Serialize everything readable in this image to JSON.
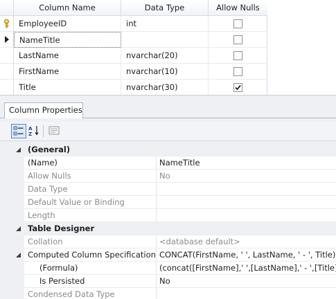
{
  "grid": {
    "headers": [
      "Column Name",
      "Data Type",
      "Allow Nulls"
    ],
    "rows": [
      {
        "name": "EmployeeID",
        "type": "int",
        "allow_nulls": false,
        "marker": "key-icon"
      },
      {
        "name": "NameTitle",
        "type": "",
        "allow_nulls": false,
        "marker": "row-pointer-icon"
      },
      {
        "name": "LastName",
        "type": "nvarchar(20)",
        "allow_nulls": false,
        "marker": ""
      },
      {
        "name": "FirstName",
        "type": "nvarchar(10)",
        "allow_nulls": false,
        "marker": ""
      },
      {
        "name": "Title",
        "type": "nvarchar(30)",
        "allow_nulls": true,
        "marker": ""
      }
    ]
  },
  "properties": {
    "tab_label": "Column Properties",
    "toolbar": [
      "categorized-icon",
      "alphabetical-sort-icon",
      "property-pages-icon"
    ],
    "rows": [
      {
        "kind": "cat",
        "name": "(General)",
        "value": ""
      },
      {
        "kind": "prop",
        "name": "(Name)",
        "value": "NameTitle",
        "dim": false
      },
      {
        "kind": "prop",
        "name": "Allow Nulls",
        "value": "No",
        "dim": true
      },
      {
        "kind": "prop",
        "name": "Data Type",
        "value": "",
        "dim": true
      },
      {
        "kind": "prop",
        "name": "Default Value or Binding",
        "value": "",
        "dim": true
      },
      {
        "kind": "prop",
        "name": "Length",
        "value": "",
        "dim": true
      },
      {
        "kind": "cat",
        "name": "Table Designer",
        "value": ""
      },
      {
        "kind": "prop",
        "name": "Collation",
        "value": "<database default>",
        "dim": true
      },
      {
        "kind": "expanded",
        "name": "Computed Column Specification",
        "value": "CONCAT(FirstName, ' ', LastName, ' - ', Title)",
        "dim": false
      },
      {
        "kind": "sub",
        "name": "(Formula)",
        "value": "(concat([FirstName],' ',[LastName],' - ',[Title]))",
        "dim": false
      },
      {
        "kind": "sub",
        "name": "Is Persisted",
        "value": "No",
        "dim": false
      },
      {
        "kind": "prop",
        "name": "Condensed Data Type",
        "value": "",
        "dim": true
      }
    ]
  },
  "colors": {
    "border": "#d6dbe4",
    "panel": "#eef0f4",
    "accent": "#5c86c9"
  }
}
